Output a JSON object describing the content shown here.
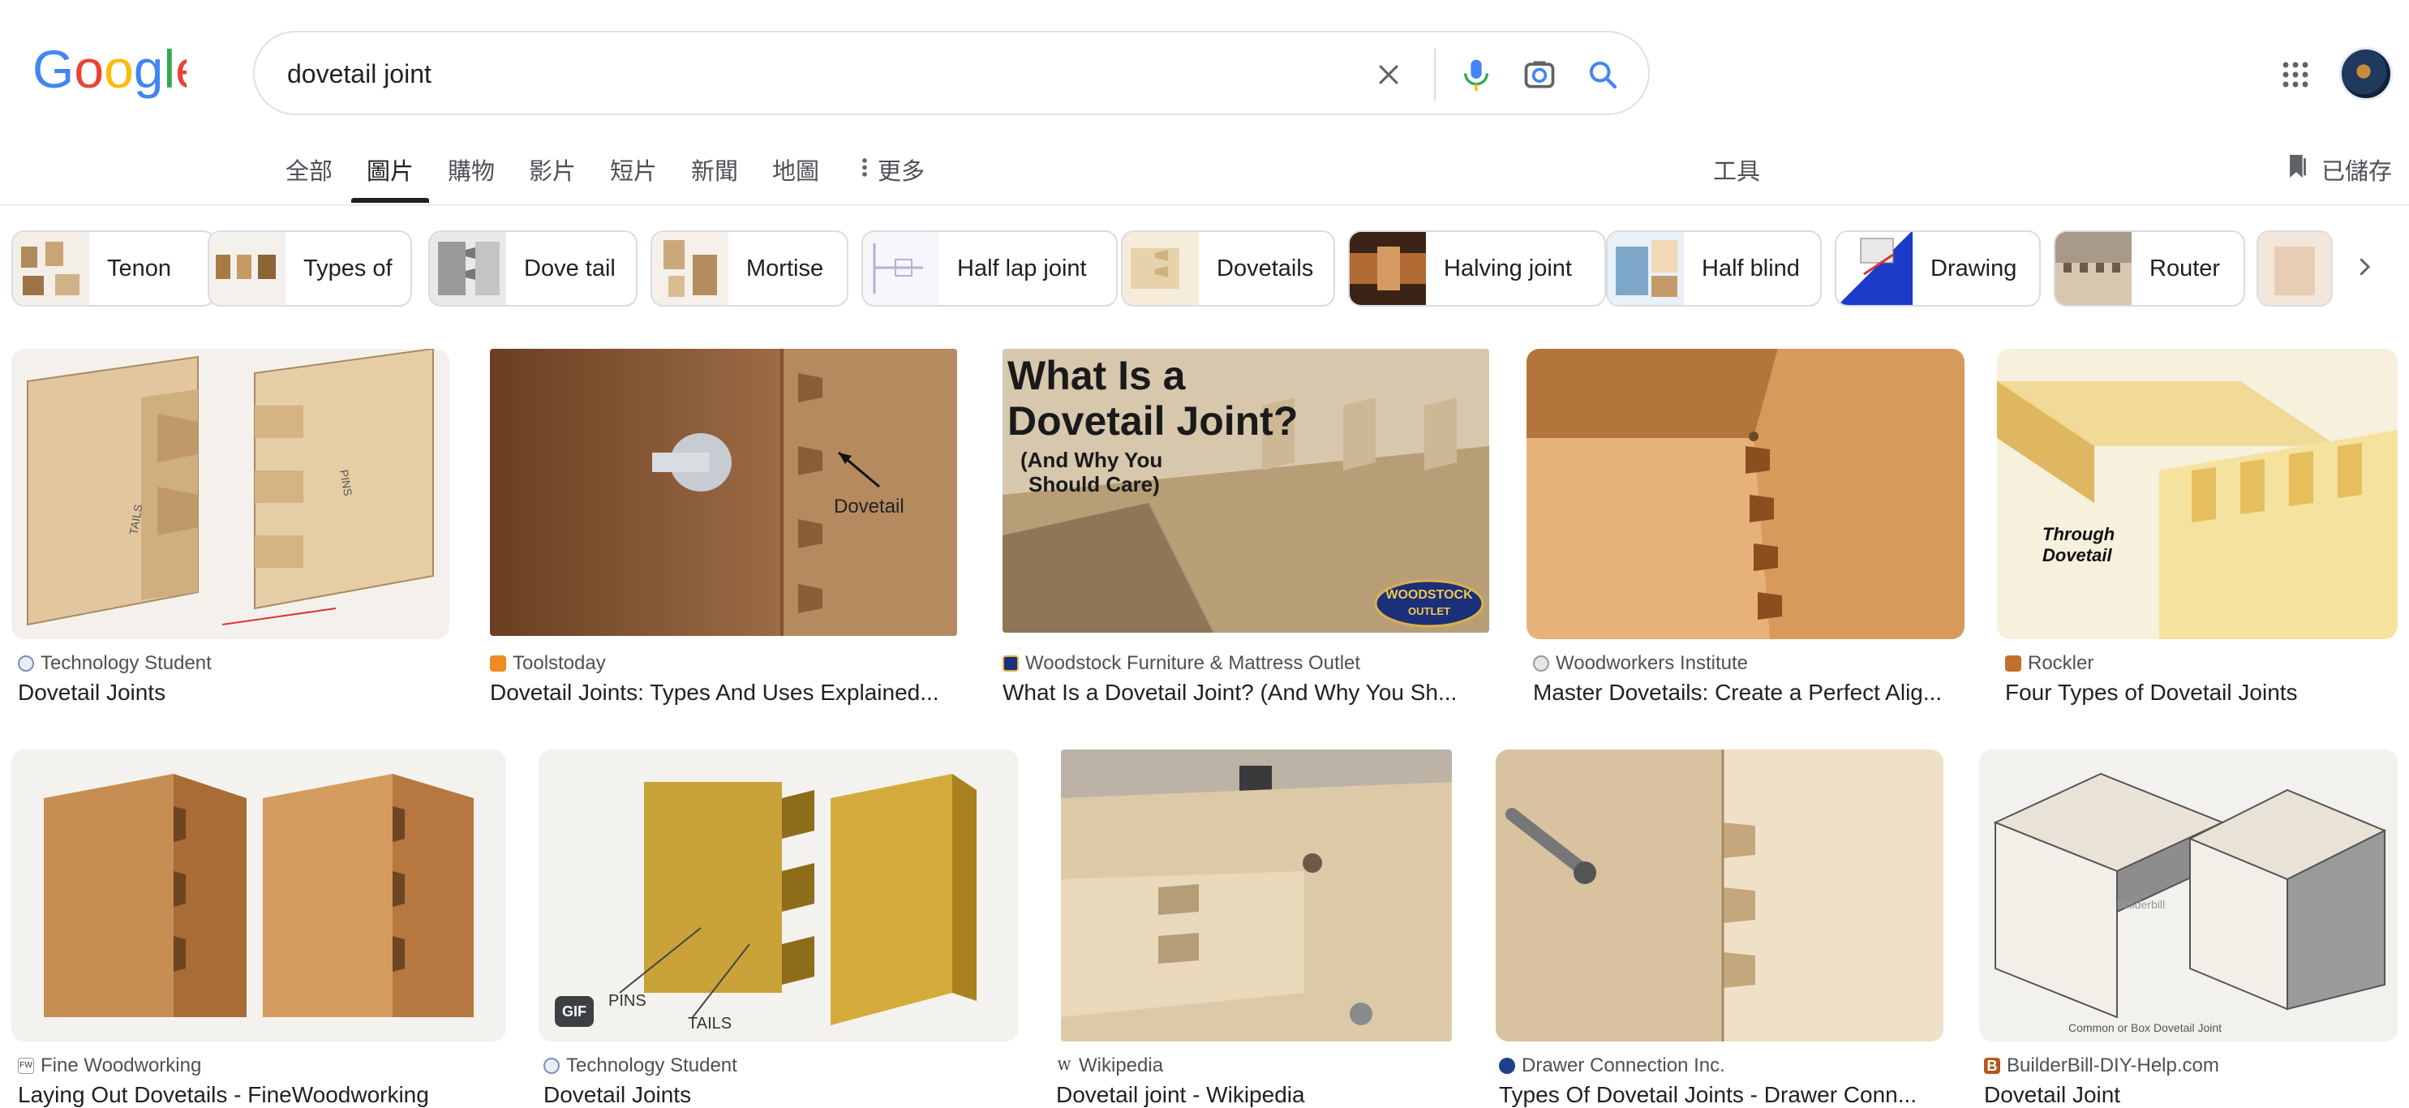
{
  "search": {
    "query": "dovetail joint"
  },
  "tabs": [
    {
      "label": "全部"
    },
    {
      "label": "圖片"
    },
    {
      "label": "購物"
    },
    {
      "label": "影片"
    },
    {
      "label": "短片"
    },
    {
      "label": "新聞"
    },
    {
      "label": "地圖"
    },
    {
      "label": "更多"
    }
  ],
  "tools_label": "工具",
  "saved_label": "已儲存",
  "chips": [
    {
      "label": "Tenon"
    },
    {
      "label": "Types of"
    },
    {
      "label": "Dove tail"
    },
    {
      "label": "Mortise"
    },
    {
      "label": "Half lap joint"
    },
    {
      "label": "Dovetails"
    },
    {
      "label": "Halving joint"
    },
    {
      "label": "Half blind"
    },
    {
      "label": "Drawing"
    },
    {
      "label": "Router"
    }
  ],
  "results_row1": [
    {
      "source": "Technology Student",
      "title": "Dovetail Joints",
      "img_text": [
        "TAILS",
        "PINS"
      ]
    },
    {
      "source": "Toolstoday",
      "title": "Dovetail Joints: Types And Uses Explained...",
      "img_text": [
        "Dovetail"
      ]
    },
    {
      "source": "Woodstock Furniture & Mattress Outlet",
      "title": "What Is a Dovetail Joint? (And Why You Sh...",
      "img_text": [
        "What Is a",
        "Dovetail Joint?",
        "(And Why You",
        "Should Care)",
        "WOODSTOCK",
        "OUTLET"
      ]
    },
    {
      "source": "Woodworkers Institute",
      "title": "Master Dovetails: Create a Perfect Alig..."
    },
    {
      "source": "Rockler",
      "title": "Four Types of Dovetail Joints",
      "img_text": [
        "Through",
        "Dovetail"
      ]
    }
  ],
  "results_row2": [
    {
      "source": "Fine Woodworking",
      "title": "Laying Out Dovetails - FineWoodworking"
    },
    {
      "source": "Technology Student",
      "title": "Dovetail Joints",
      "badge": "GIF",
      "img_text": [
        "PINS",
        "TAILS"
      ]
    },
    {
      "source": "Wikipedia",
      "title": "Dovetail joint - Wikipedia"
    },
    {
      "source": "Drawer Connection Inc.",
      "title": "Types Of Dovetail Joints - Drawer Conn..."
    },
    {
      "source": "BuilderBill-DIY-Help.com",
      "title": "Dovetail Joint",
      "img_text": [
        "builderbill",
        "Common or Box Dovetail Joint"
      ]
    }
  ],
  "colors": {
    "google_blue": "#4285F4",
    "google_red": "#EA4335",
    "google_yellow": "#FBBC05",
    "google_green": "#34A853"
  }
}
